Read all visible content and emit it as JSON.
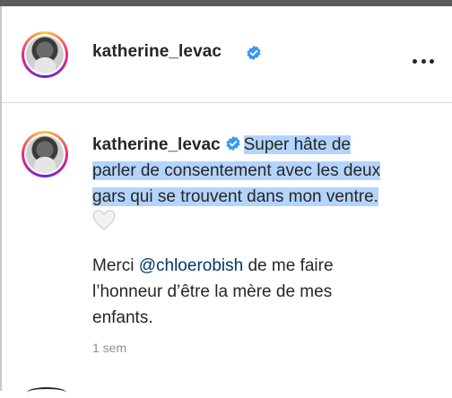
{
  "header": {
    "username": "katherine_levac",
    "verified": true,
    "more_icon": "more-horizontal-icon"
  },
  "comment": {
    "username": "katherine_levac",
    "verified": true,
    "text_line1": "Super hâte de",
    "text_line2": "parler de consentement avec les deux",
    "text_line3": "gars qui se trouvent dans mon ventre.",
    "emoji_icon": "white-heart-icon",
    "p2_before": "Merci ",
    "mention": "@chloerobish",
    "p2_after_line1": " de me faire",
    "p2_line2": "l’honneur d’être la mère de mes",
    "p2_line3": "enfants.",
    "timestamp": "1 sem"
  },
  "colors": {
    "verified": "#3897f0",
    "mention": "#00376b",
    "selection": "#b3d4fc",
    "muted": "#8e8e8e"
  }
}
